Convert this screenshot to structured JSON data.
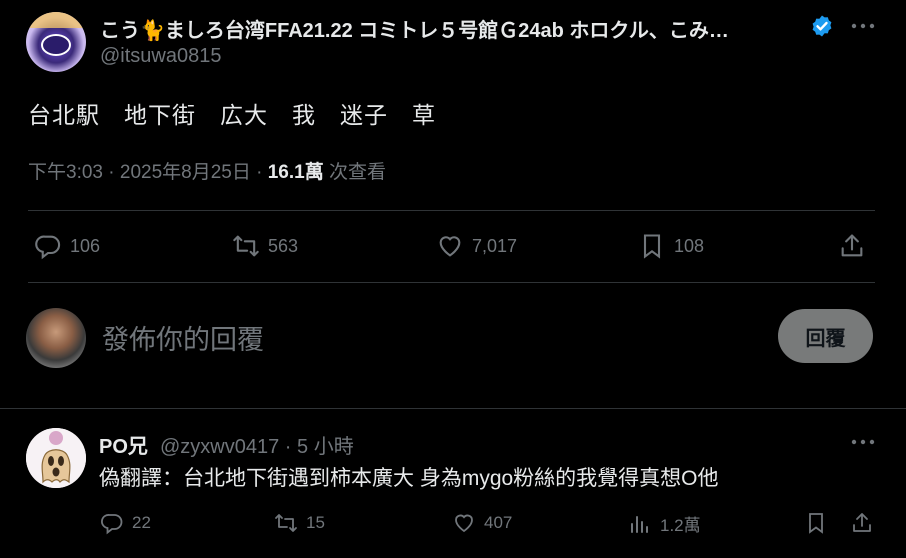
{
  "tweet": {
    "display_name": "こう🐈ましろ台湾FFA21.22 コミトレ５号館Ｇ24ab ホロクル、こみ…",
    "handle": "@itsuwa0815",
    "text": "台北駅　地下街　広大　我　迷子　草",
    "meta": {
      "time": "下午3:03",
      "date": "2025年8月25日",
      "views": "16.1萬",
      "views_label": "次查看"
    },
    "stats": {
      "replies": "106",
      "retweets": "563",
      "likes": "7,017",
      "bookmarks": "108"
    }
  },
  "compose": {
    "placeholder": "發佈你的回覆",
    "button": "回覆"
  },
  "reply": {
    "name": "PO兄",
    "handle_time": "@zyxwv0417 · 5 小時",
    "text": "偽翻譯：台北地下街遇到柿本廣大 身為mygo粉絲的我覺得真想O他",
    "stats": {
      "replies": "22",
      "retweets": "15",
      "likes": "407",
      "views": "1.2萬"
    }
  },
  "colors": {
    "background": "#000000",
    "text": "#e7e9ea",
    "muted": "#71767b",
    "border": "#2f3336",
    "verified": "#1d9bf0",
    "reply_button": "#787a7a"
  }
}
